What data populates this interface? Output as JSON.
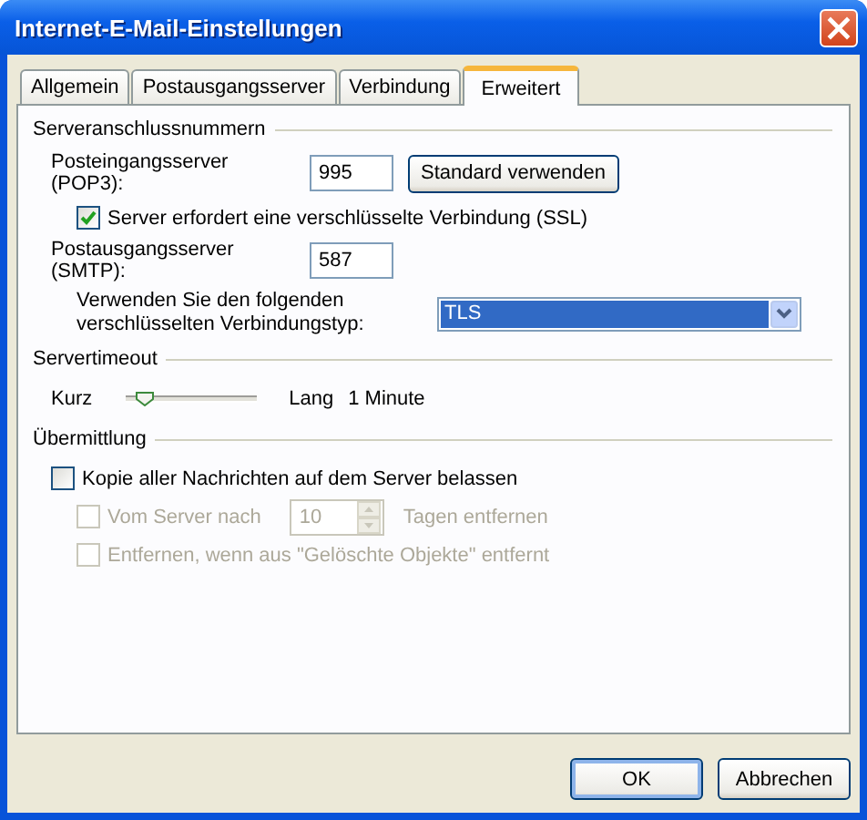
{
  "window": {
    "title": "Internet-E-Mail-Einstellungen"
  },
  "tabs": [
    {
      "label": "Allgemein",
      "selected": false
    },
    {
      "label": "Postausgangsserver",
      "selected": false
    },
    {
      "label": "Verbindung",
      "selected": false
    },
    {
      "label": "Erweitert",
      "selected": true
    }
  ],
  "server_ports": {
    "heading": "Serveranschlussnummern",
    "incoming": {
      "label": "Posteingangsserver (POP3):",
      "value": "995"
    },
    "default_button": "Standard verwenden",
    "ssl": {
      "label": "Server erfordert eine verschlüsselte Verbindung (SSL)",
      "checked": true
    },
    "outgoing": {
      "label": "Postausgangsserver (SMTP):",
      "value": "587"
    },
    "encryption": {
      "label": "Verwenden Sie den folgenden verschlüsselten Verbindungstyp:",
      "value": "TLS"
    }
  },
  "timeout": {
    "heading": "Servertimeout",
    "min_label": "Kurz",
    "level": 0.08,
    "max_label": "Lang",
    "reading": "1 Minute"
  },
  "delivery": {
    "heading": "Übermittlung",
    "keep_copy": {
      "label": "Kopie aller Nachrichten auf dem Server belassen",
      "checked": false,
      "disabled": false
    },
    "remove_after": {
      "label": "Vom Server nach",
      "value": "10",
      "unit": "Tagen entfernen",
      "checked": false,
      "disabled": true
    },
    "remove_deleted": {
      "label": "Entfernen, wenn aus \"Gelöschte Objekte\" entfernt",
      "checked": false,
      "disabled": true
    }
  },
  "buttons": [
    {
      "label": "OK",
      "default": true
    },
    {
      "label": "Abbrechen",
      "default": false
    }
  ]
}
